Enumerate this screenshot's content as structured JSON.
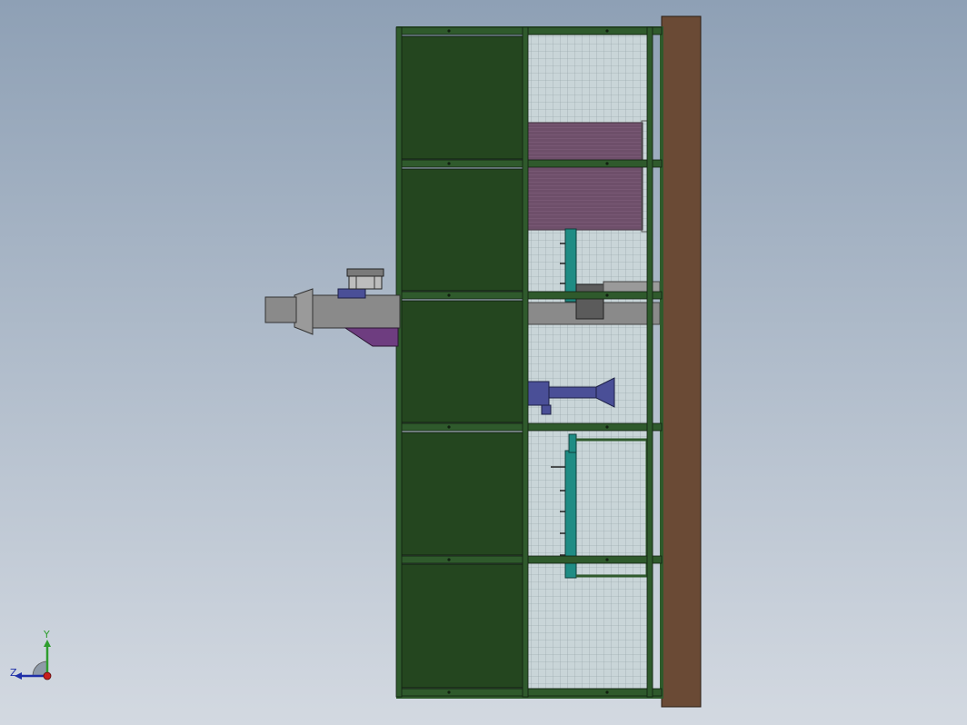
{
  "viewport": {
    "background_top": "#8ea0b5",
    "background_bottom": "#d3d9e1"
  },
  "model": {
    "frame_color": "#2f5a2c",
    "panel_color": "#24461f",
    "mesh_color": "#c9d5d8",
    "base_color": "#6a4a35",
    "conveyor_color": "#1f8c84",
    "motor_color": "#4a4f97",
    "curtain_color": "#6e4f6a",
    "hopper_color": "#8a8a8a"
  },
  "triad": {
    "y_label": "Y",
    "z_label": "Z",
    "y_color": "#2e9d2e",
    "z_color": "#1f2fa8",
    "origin_color": "#c81e1e"
  }
}
